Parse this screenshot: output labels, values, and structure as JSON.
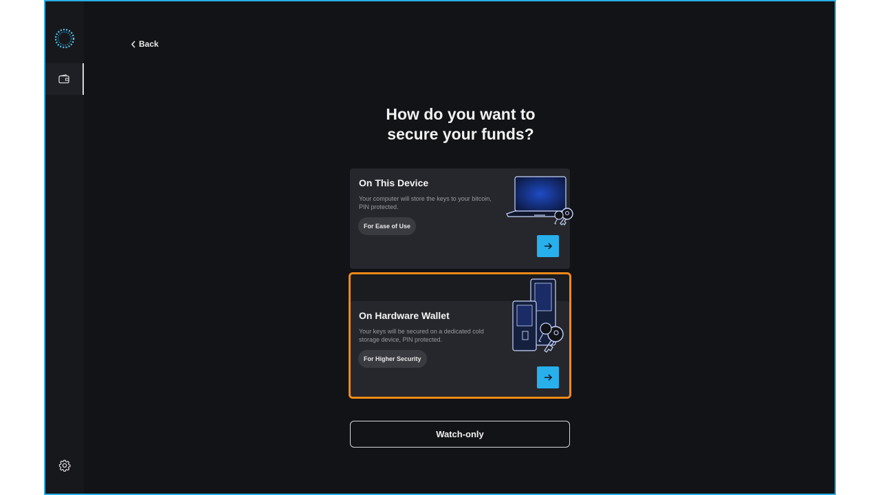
{
  "nav": {
    "back_label": "Back"
  },
  "page": {
    "title_line1": "How do you want to",
    "title_line2": "secure your funds?"
  },
  "options": [
    {
      "title": "On This Device",
      "description": "Your computer will store the keys to your bitcoin, PIN protected.",
      "tag": "For Ease of Use"
    },
    {
      "title": "On Hardware Wallet",
      "description": "Your keys will be secured on a dedicated cold storage device, PIN protected.",
      "tag": "For Higher Security"
    }
  ],
  "watch_only": {
    "label": "Watch-only"
  },
  "icons": {
    "logo": "app-logo-ring",
    "wallet": "wallet-icon",
    "settings": "gear-icon",
    "back": "chevron-left-icon",
    "arrow": "arrow-right-icon"
  },
  "colors": {
    "accent": "#27b0ec",
    "highlight": "#f28a17",
    "background": "#121316",
    "card": "#26272c"
  }
}
